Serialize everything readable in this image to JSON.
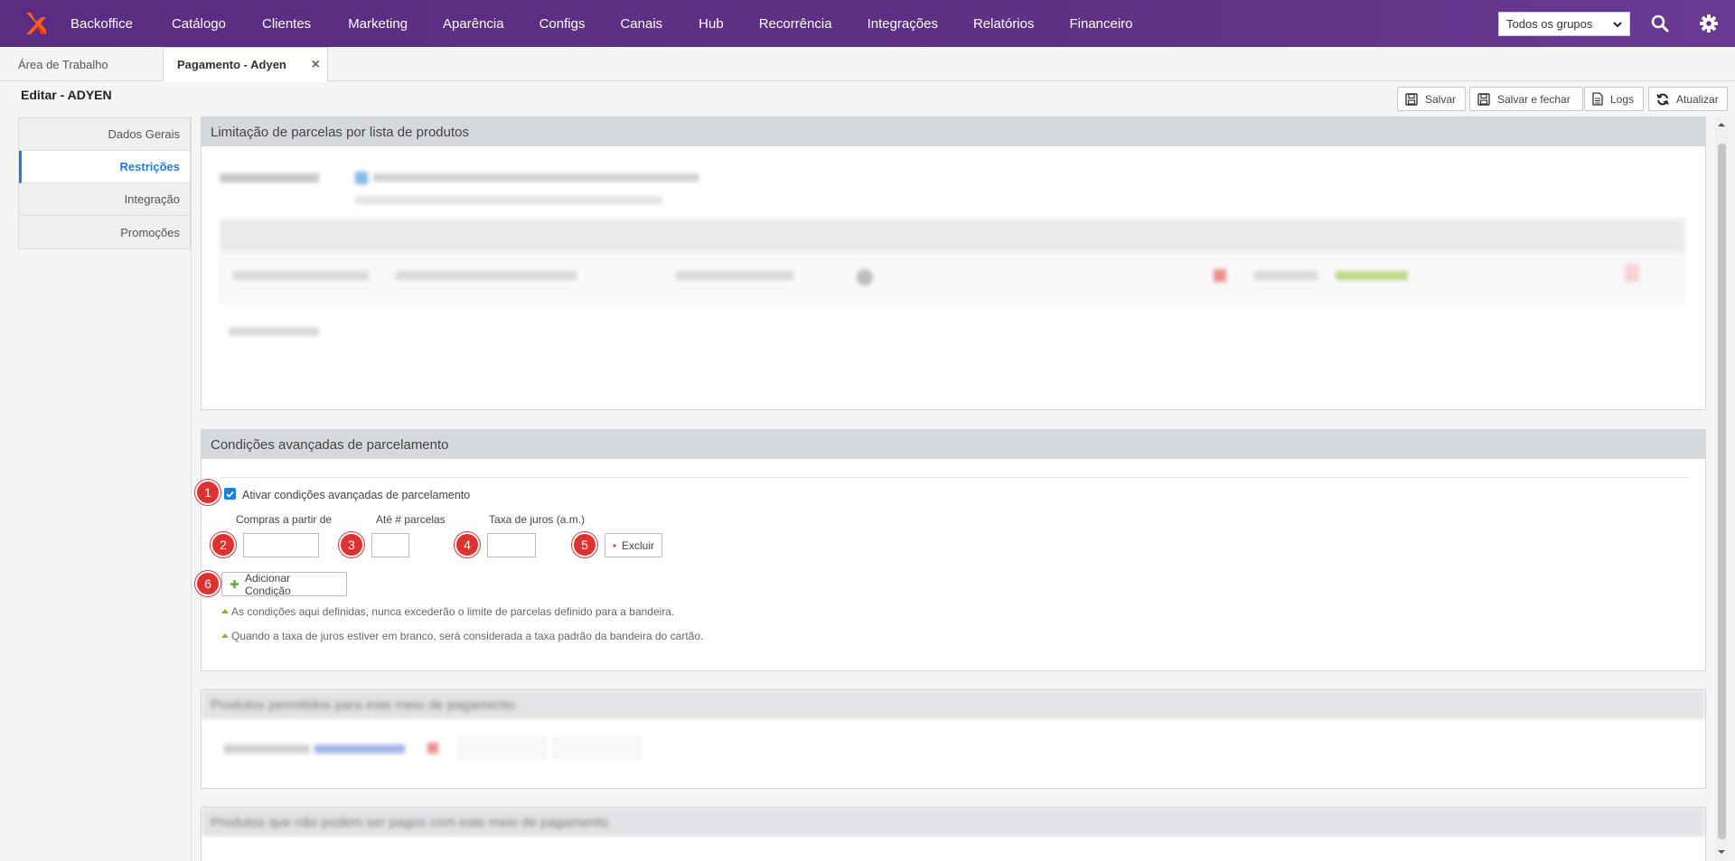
{
  "nav": {
    "items": [
      "Backoffice",
      "Catálogo",
      "Clientes",
      "Marketing",
      "Aparência",
      "Configs",
      "Canais",
      "Hub",
      "Recorrência",
      "Integrações",
      "Relatórios",
      "Financeiro"
    ],
    "group_select": "Todos os grupos"
  },
  "tabs": {
    "workspace": "Área de Trabalho",
    "active": "Pagamento - Adyen",
    "close": "×"
  },
  "page": {
    "title": "Editar - ADYEN"
  },
  "toolbar": {
    "save": "Salvar",
    "save_close": "Salvar e fechar",
    "logs": "Logs",
    "refresh": "Atualizar"
  },
  "leftmenu": {
    "items": [
      "Dados Gerais",
      "Restrições",
      "Integração",
      "Promoções"
    ]
  },
  "sections": {
    "limit_title": "Limitação de parcelas por lista de produtos",
    "advanced_title": "Condições avançadas de parcelamento",
    "enable_label": "Ativar condições avançadas de parcelamento",
    "col_from": "Compras a partir de",
    "col_upto": "Até # parcelas",
    "col_rate": "Taxa de juros (a.m.)",
    "delete": "Excluir",
    "add_condition": "Adicionar Condição",
    "note1": "As condições aqui definidas, nunca excederão o limite de parcelas definido para a bandeira.",
    "note2": "Quando a taxa de juros estiver em branco, será considerada a taxa padrão da bandeira do cartão.",
    "allowed_title": "Produtos permitidos para este meio de pagamento",
    "denied_title": "Produtos que não podem ser pagos com este meio de pagamento"
  },
  "badges": [
    "1",
    "2",
    "3",
    "4",
    "5",
    "6"
  ],
  "colors": {
    "nav_bg": "#5a2d82",
    "accent_blue": "#1f7ed8",
    "badge_red": "#e03131",
    "panel_head": "#d5d8dc"
  }
}
